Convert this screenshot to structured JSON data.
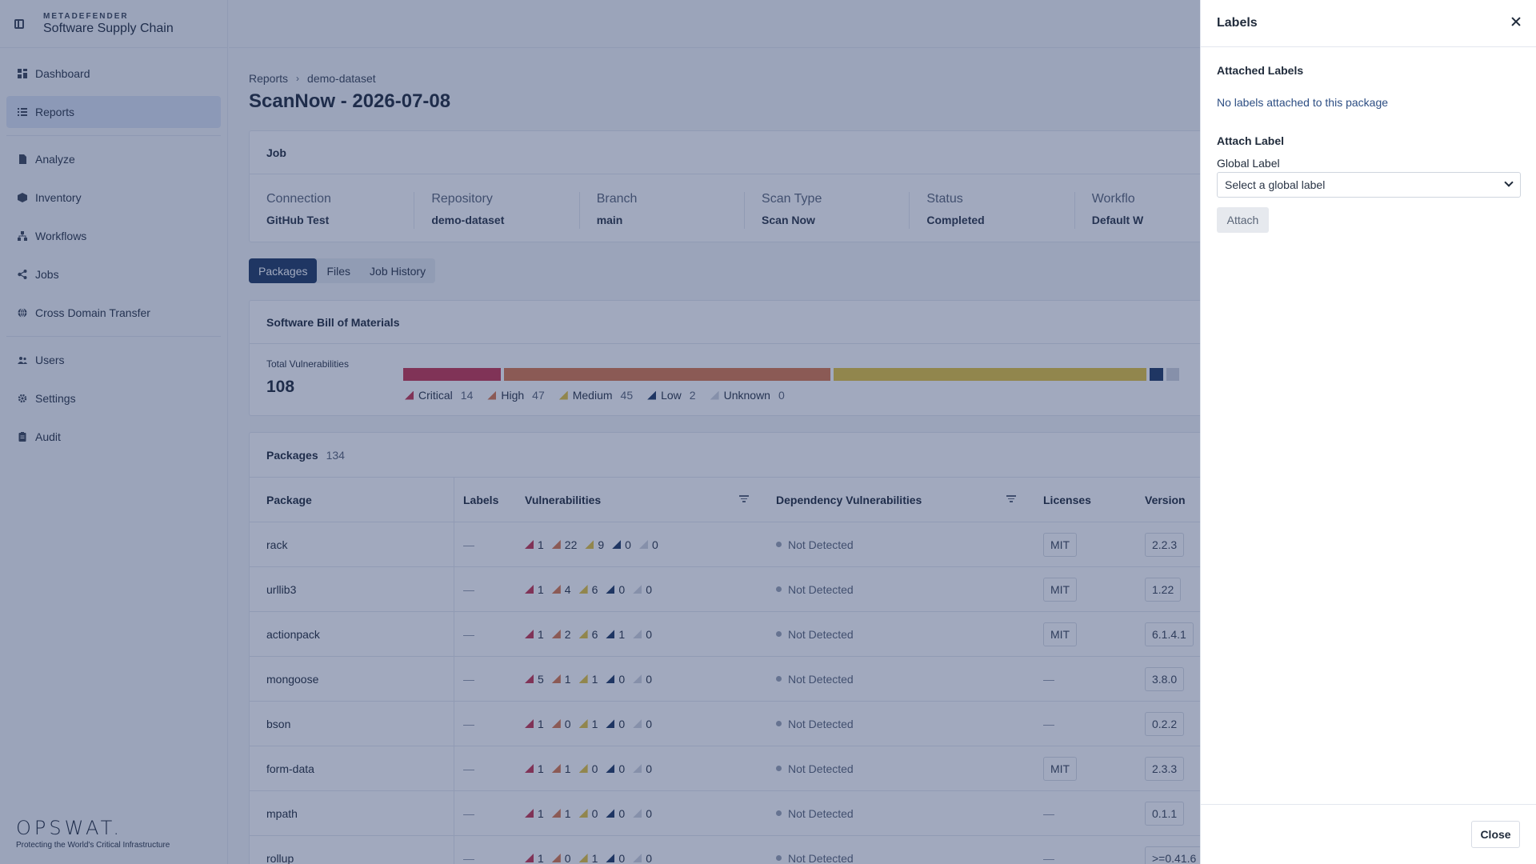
{
  "brand": {
    "small": "METADEFENDER",
    "big": "Software Supply Chain"
  },
  "nav": {
    "items": [
      {
        "label": "Dashboard",
        "icon": "dashboard-icon"
      },
      {
        "label": "Reports",
        "icon": "list-icon"
      },
      {
        "label": "Analyze",
        "icon": "file-icon"
      },
      {
        "label": "Inventory",
        "icon": "box-icon"
      },
      {
        "label": "Workflows",
        "icon": "workflow-icon"
      },
      {
        "label": "Jobs",
        "icon": "share-icon"
      },
      {
        "label": "Cross Domain Transfer",
        "icon": "globe-icon"
      },
      {
        "label": "Users",
        "icon": "users-icon"
      },
      {
        "label": "Settings",
        "icon": "gear-icon"
      },
      {
        "label": "Audit",
        "icon": "clipboard-icon"
      }
    ]
  },
  "footer": {
    "logo": "OPSWAT.",
    "tagline": "Protecting the World's Critical Infrastructure"
  },
  "breadcrumb": {
    "root": "Reports",
    "current": "demo-dataset"
  },
  "page": {
    "title": "ScanNow - 2026-07-08"
  },
  "job": {
    "title": "Job",
    "fields": [
      {
        "label": "Connection",
        "value": "GitHub Test"
      },
      {
        "label": "Repository",
        "value": "demo-dataset"
      },
      {
        "label": "Branch",
        "value": "main"
      },
      {
        "label": "Scan Type",
        "value": "Scan Now"
      },
      {
        "label": "Status",
        "value": "Completed"
      },
      {
        "label": "Workflo",
        "value": "Default W"
      }
    ]
  },
  "tabs": [
    "Packages",
    "Files",
    "Job History"
  ],
  "sbom": {
    "title": "Software Bill of Materials",
    "total_label": "Total Vulnerabilities",
    "total_value": "108",
    "severity": [
      {
        "name": "Critical",
        "count": 14,
        "color": "#c7354e"
      },
      {
        "name": "High",
        "count": 47,
        "color": "#d9774a"
      },
      {
        "name": "Medium",
        "count": 45,
        "color": "#e3c33d"
      },
      {
        "name": "Low",
        "count": 2,
        "color": "#1f3a63"
      },
      {
        "name": "Unknown",
        "count": 0,
        "color": "#d0d5dd"
      }
    ]
  },
  "packages": {
    "title": "Packages",
    "count": "134",
    "columns": [
      "Package",
      "Labels",
      "Vulnerabilities",
      "Dependency Vulnerabilities",
      "Licenses",
      "Version"
    ],
    "rows": [
      {
        "name": "rack",
        "labels": "—",
        "vulns": [
          "1",
          "22",
          "9",
          "0",
          "0"
        ],
        "dep": "Not Detected",
        "license": "MIT",
        "version": "2.2.3"
      },
      {
        "name": "urllib3",
        "labels": "—",
        "vulns": [
          "1",
          "4",
          "6",
          "0",
          "0"
        ],
        "dep": "Not Detected",
        "license": "MIT",
        "version": "1.22"
      },
      {
        "name": "actionpack",
        "labels": "—",
        "vulns": [
          "1",
          "2",
          "6",
          "1",
          "0"
        ],
        "dep": "Not Detected",
        "license": "MIT",
        "version": "6.1.4.1"
      },
      {
        "name": "mongoose",
        "labels": "—",
        "vulns": [
          "5",
          "1",
          "1",
          "0",
          "0"
        ],
        "dep": "Not Detected",
        "license": "—",
        "version": "3.8.0"
      },
      {
        "name": "bson",
        "labels": "—",
        "vulns": [
          "1",
          "0",
          "1",
          "0",
          "0"
        ],
        "dep": "Not Detected",
        "license": "—",
        "version": "0.2.2"
      },
      {
        "name": "form-data",
        "labels": "—",
        "vulns": [
          "1",
          "1",
          "0",
          "0",
          "0"
        ],
        "dep": "Not Detected",
        "license": "MIT",
        "version": "2.3.3"
      },
      {
        "name": "mpath",
        "labels": "—",
        "vulns": [
          "1",
          "1",
          "0",
          "0",
          "0"
        ],
        "dep": "Not Detected",
        "license": "—",
        "version": "0.1.1"
      },
      {
        "name": "rollup",
        "labels": "—",
        "vulns": [
          "1",
          "0",
          "1",
          "0",
          "0"
        ],
        "dep": "Not Detected",
        "license": "—",
        "version": ">=0.41.6"
      }
    ]
  },
  "drawer": {
    "title": "Labels",
    "attached_heading": "Attached Labels",
    "empty_text": "No labels attached to this package",
    "attach_heading": "Attach Label",
    "global_label": "Global Label",
    "select_placeholder": "Select a global label",
    "attach_button": "Attach",
    "close_button": "Close"
  }
}
